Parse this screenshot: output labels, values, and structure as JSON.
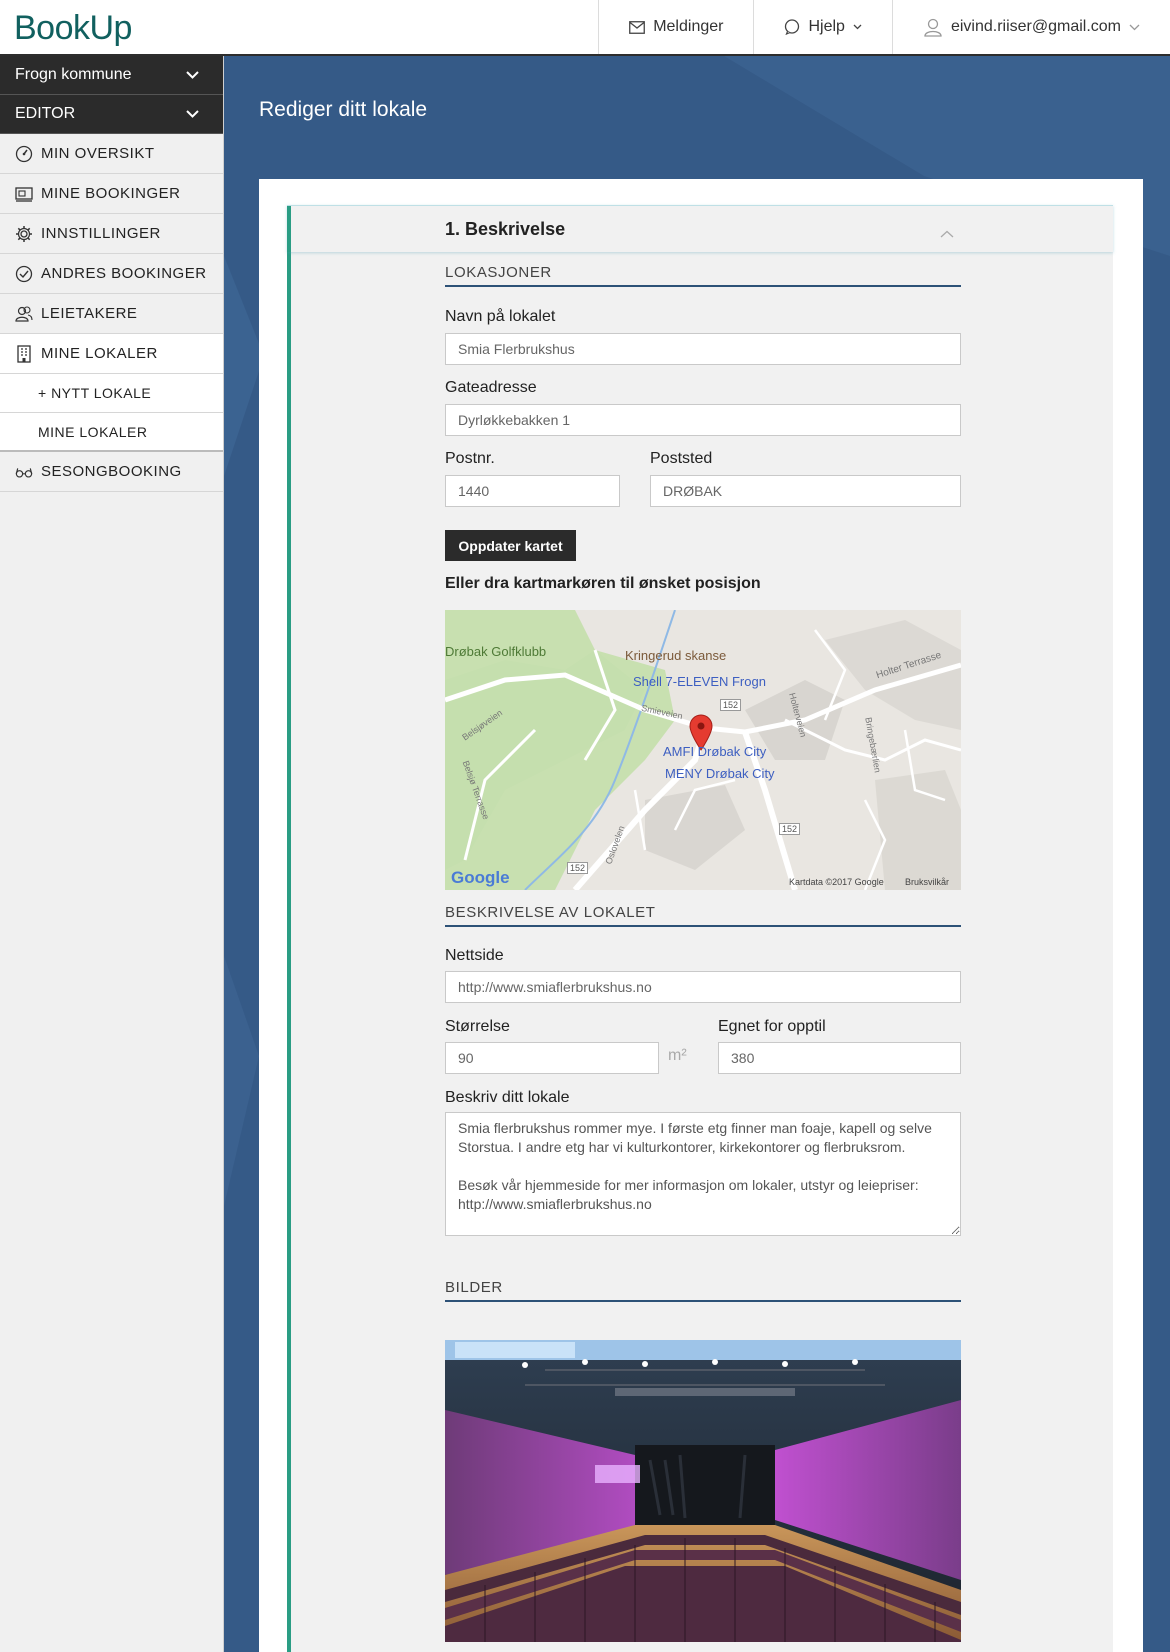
{
  "header": {
    "logo": "BookUp",
    "messages_label": "Meldinger",
    "help_label": "Hjelp",
    "user_email": "eivind.riiser@gmail.com"
  },
  "sidebar": {
    "municipality": "Frogn kommune",
    "role": "EDITOR",
    "items": [
      {
        "label": "MIN OVERSIKT",
        "icon": "dashboard-icon"
      },
      {
        "label": "MINE BOOKINGER",
        "icon": "booking-icon"
      },
      {
        "label": "INNSTILLINGER",
        "icon": "gear-icon"
      },
      {
        "label": "ANDRES BOOKINGER",
        "icon": "check-circle-icon"
      },
      {
        "label": "LEIETAKERE",
        "icon": "users-icon"
      },
      {
        "label": "MINE LOKALER",
        "icon": "building-icon"
      }
    ],
    "subitems": [
      "+ NYTT LOKALE",
      "MINE LOKALER"
    ],
    "season": {
      "label": "SESONGBOOKING",
      "icon": "glasses-icon"
    }
  },
  "main": {
    "page_title": "Rediger ditt lokale",
    "section_title": "1. Beskrivelse",
    "locations_heading": "LOKASJONER",
    "venue_name_label": "Navn på lokalet",
    "venue_name_value": "Smia Flerbrukshus",
    "street_label": "Gateadresse",
    "street_value": "Dyrløkkebakken 1",
    "postcode_label": "Postnr.",
    "postcode_value": "1440",
    "city_label": "Poststed",
    "city_value": "DRØBAK",
    "update_map_button": "Oppdater kartet",
    "drag_hint": "Eller dra kartmarkøren til ønsket posisjon",
    "map": {
      "labels": {
        "golfklubb": "Drøbak Golfklubb",
        "skanse": "Kringerud skanse",
        "shell": "Shell 7-ELEVEN Frogn",
        "amfi": "AMFI Drøbak City",
        "meny": "MENY Drøbak City",
        "holter": "Holter Terrasse",
        "smieveien": "Smieveien",
        "belsjoveien": "Belsjøveien",
        "belsjo_terrasse": "Belsjø Terrasse",
        "oslovelen": "Oslovelen",
        "holterveien": "Holterveien",
        "bringebaer": "Bringebærlien",
        "rt152": "152",
        "attribution": "Kartdata ©2017 Google",
        "terms": "Bruksvilkår",
        "google": "Google"
      }
    },
    "description_heading": "BESKRIVELSE AV LOKALET",
    "website_label": "Nettside",
    "website_value": "http://www.smiaflerbrukshus.no",
    "size_label": "Størrelse",
    "size_value": "90",
    "size_unit": "m²",
    "capacity_label": "Egnet for opptil",
    "capacity_value": "380",
    "describe_label": "Beskriv ditt lokale",
    "describe_value": "Smia flerbrukshus rommer mye. I første etg finner man foaje, kapell og selve Storstua. I andre etg har vi kulturkontorer, kirkekontorer og flerbruksrom.\n\nBesøk vår hjemmeside for mer informasjon om lokaler, utstyr og leiepriser: http://www.smiaflerbrukshus.no",
    "images_heading": "BILDER"
  }
}
